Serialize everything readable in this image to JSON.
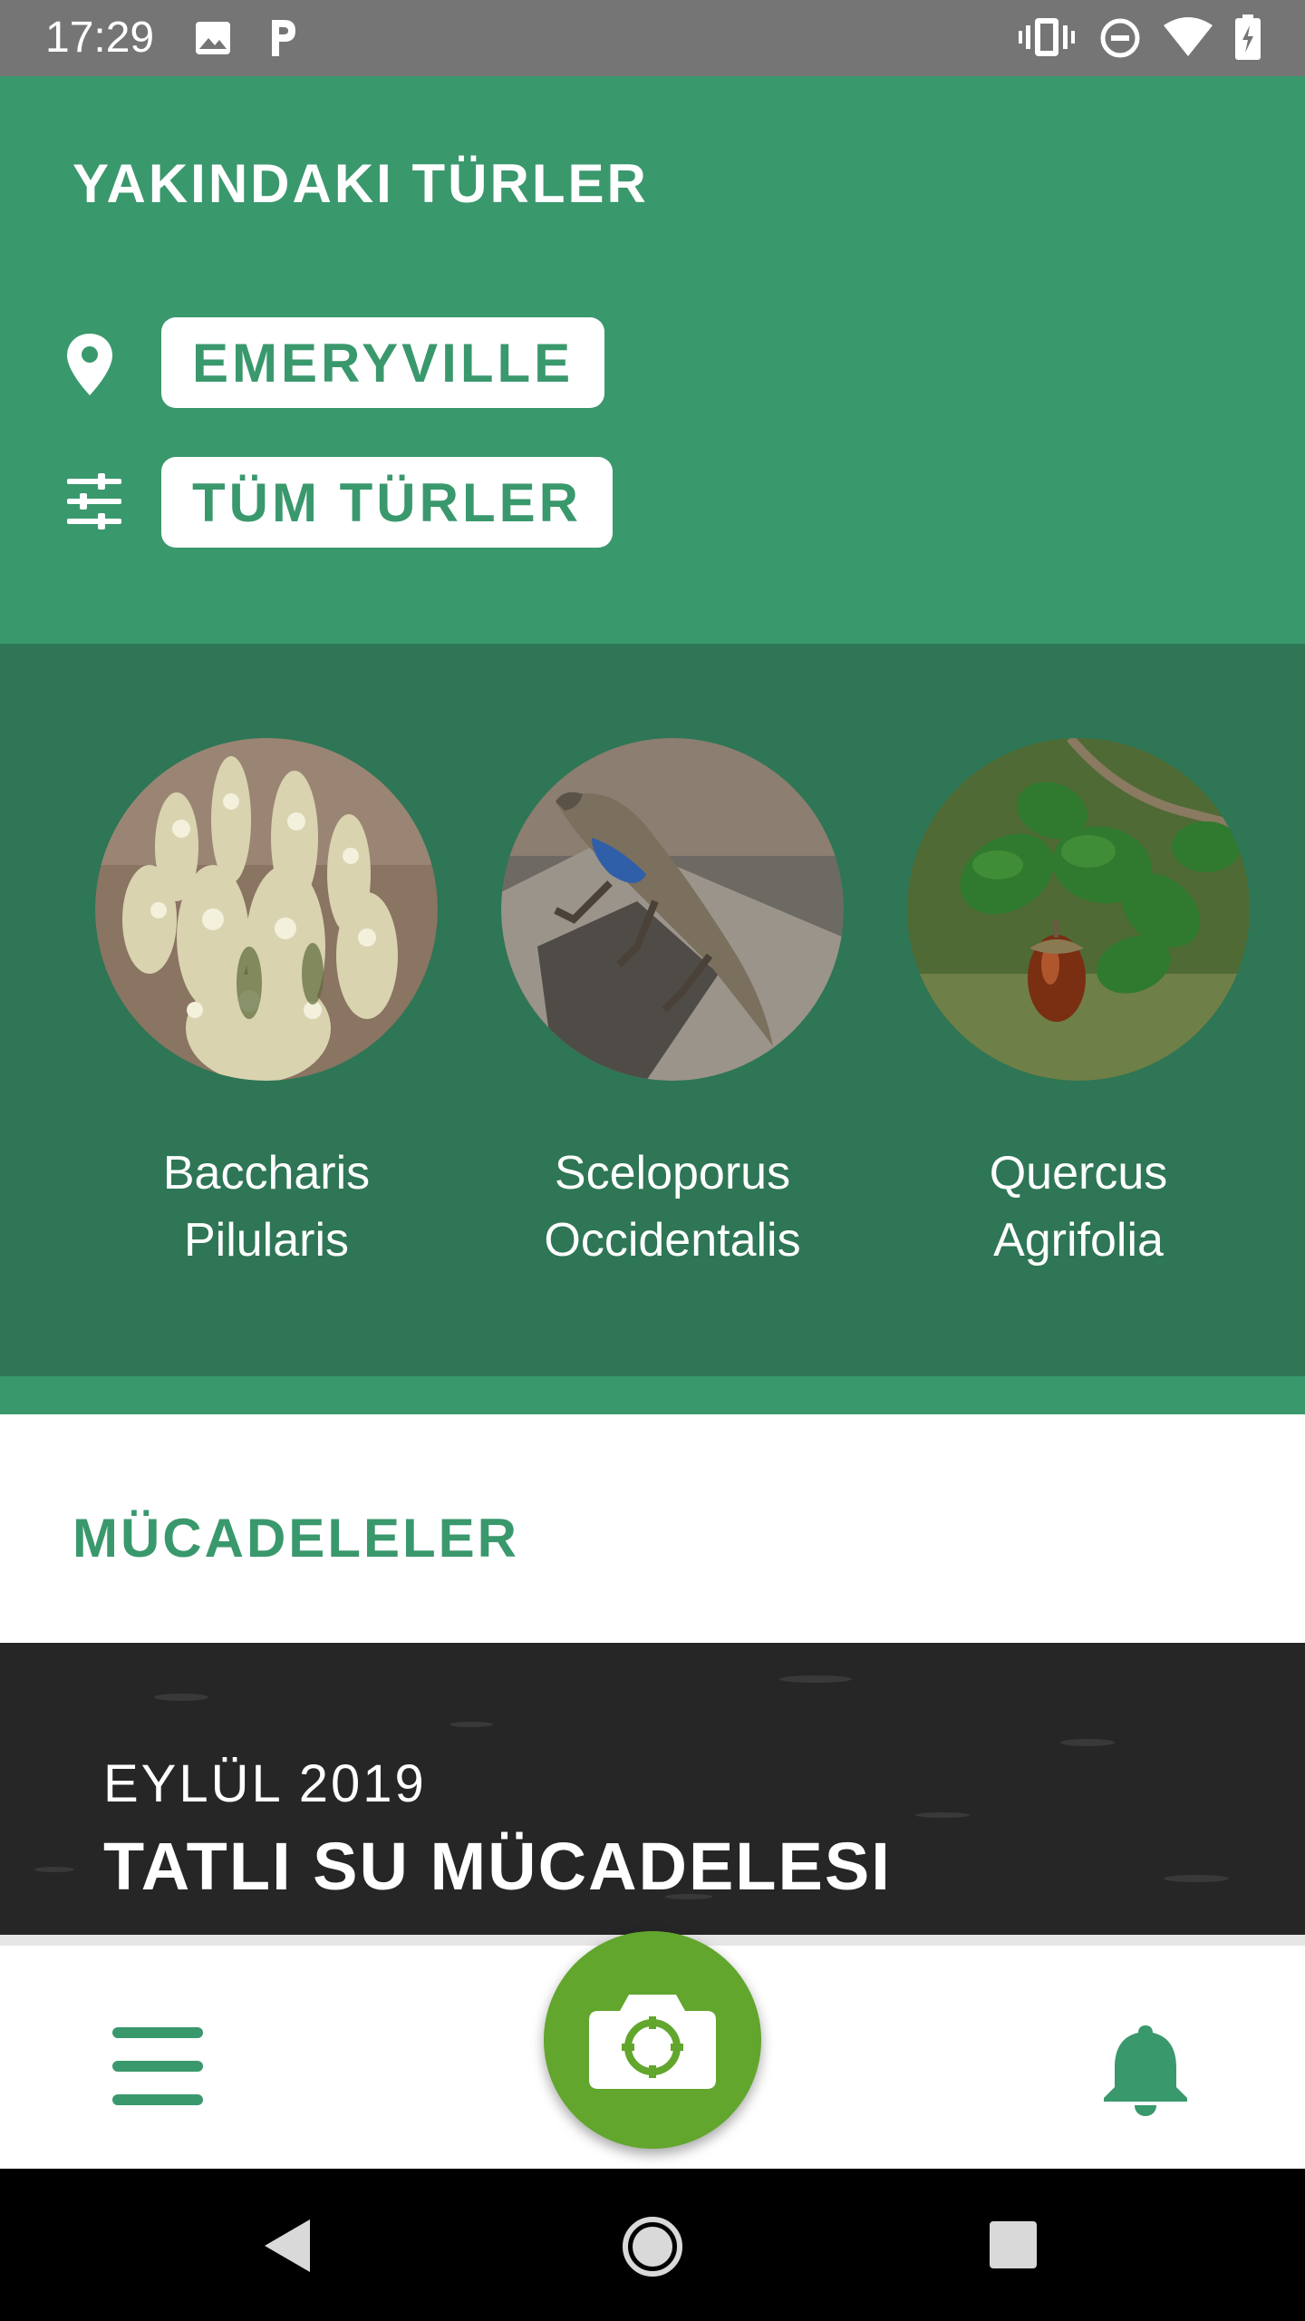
{
  "status_bar": {
    "time": "17:29",
    "icons": [
      "image-icon",
      "parking-icon",
      "vibrate-icon",
      "do-not-disturb-icon",
      "wifi-icon",
      "battery-charging-icon"
    ]
  },
  "nearby": {
    "title": "YAKINDAKI TÜRLER",
    "location_label": "EMERYVILLE",
    "filter_label": "TÜM TÜRLER"
  },
  "species": [
    {
      "line1": "Baccharis",
      "line2": "Pilularis",
      "image": "plant-photo"
    },
    {
      "line1": "Sceloporus",
      "line2": "Occidentalis",
      "image": "lizard-photo"
    },
    {
      "line1": "Quercus",
      "line2": "Agrifolia",
      "image": "oak-photo"
    }
  ],
  "challenges": {
    "title": "MÜCADELELER",
    "date": "EYLÜL 2019",
    "name": "TATLI SU MÜCADELESI"
  },
  "colors": {
    "header_green": "#3a986d",
    "dark_green": "#2e7655",
    "camera_green": "#62a62d"
  }
}
